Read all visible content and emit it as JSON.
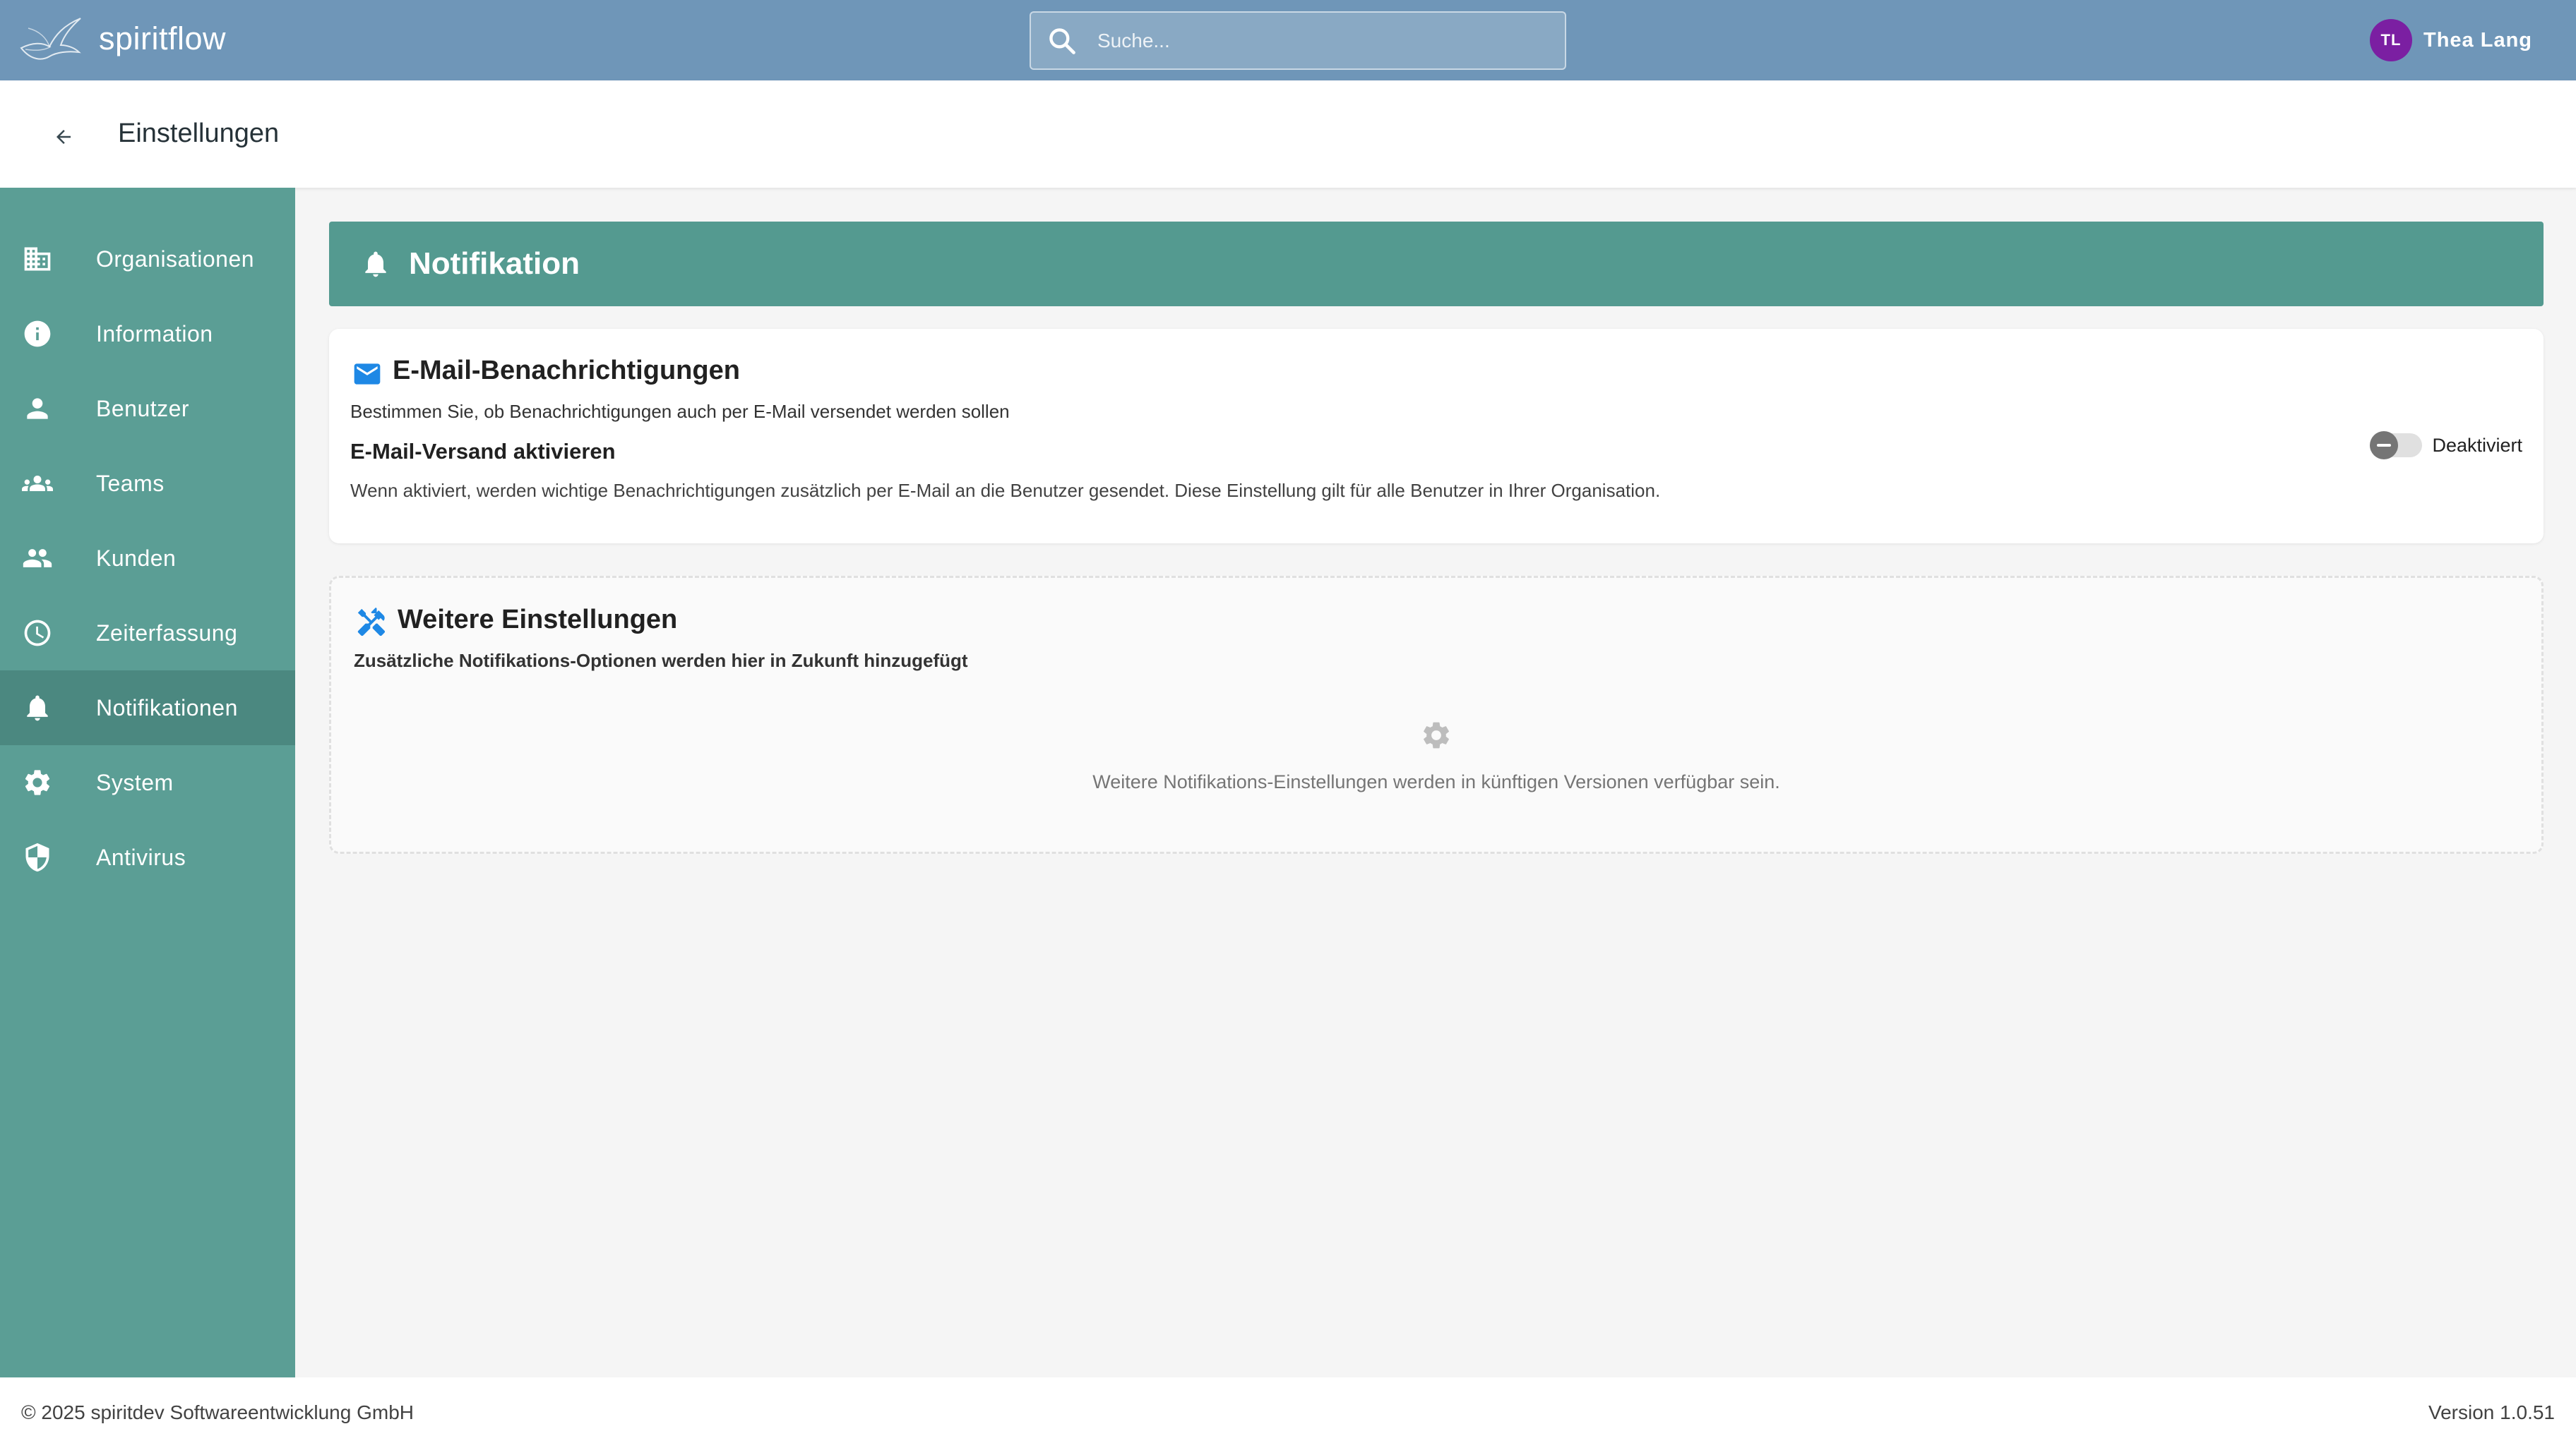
{
  "app": {
    "brand_name": "spiritflow"
  },
  "search": {
    "placeholder": "Suche..."
  },
  "user": {
    "initials": "TL",
    "name": "Thea Lang"
  },
  "subheader": {
    "title": "Einstellungen"
  },
  "sidebar": {
    "items": [
      {
        "label": "Organisationen",
        "icon": "building-icon"
      },
      {
        "label": "Information",
        "icon": "info-icon"
      },
      {
        "label": "Benutzer",
        "icon": "person-icon"
      },
      {
        "label": "Teams",
        "icon": "groups-icon"
      },
      {
        "label": "Kunden",
        "icon": "people-icon"
      },
      {
        "label": "Zeiterfassung",
        "icon": "clock-icon"
      },
      {
        "label": "Notifikationen",
        "icon": "bell-icon",
        "active": true
      },
      {
        "label": "System",
        "icon": "gear-icon"
      },
      {
        "label": "Antivirus",
        "icon": "shield-icon"
      }
    ]
  },
  "section": {
    "title": "Notifikation"
  },
  "email_card": {
    "title": "E-Mail-Benachrichtigungen",
    "subtitle": "Bestimmen Sie, ob Benachrichtigungen auch per E-Mail versendet werden sollen",
    "setting_label": "E-Mail-Versand aktivieren",
    "setting_description": "Wenn aktiviert, werden wichtige Benachrichtigungen zusätzlich per E-Mail an die Benutzer gesendet. Diese Einstellung gilt für alle Benutzer in Ihrer Organisation.",
    "toggle_label": "Deaktiviert",
    "toggle_enabled": false
  },
  "more_card": {
    "title": "Weitere Einstellungen",
    "subtitle": "Zusätzliche Notifikations-Optionen werden hier in Zukunft hinzugefügt",
    "placeholder_text": "Weitere Notifikations-Einstellungen werden in künftigen Versionen verfügbar sein."
  },
  "footer": {
    "copyright": "© 2025 spiritdev Softwareentwicklung GmbH",
    "version": "Version 1.0.51"
  },
  "colors": {
    "topbar": "#6f96b8",
    "sidebar": "#5b9e95",
    "sidebar_active": "#4b8880",
    "section_header": "#549a90",
    "accent_blue": "#1e88e5",
    "avatar": "#7b1fa2"
  }
}
